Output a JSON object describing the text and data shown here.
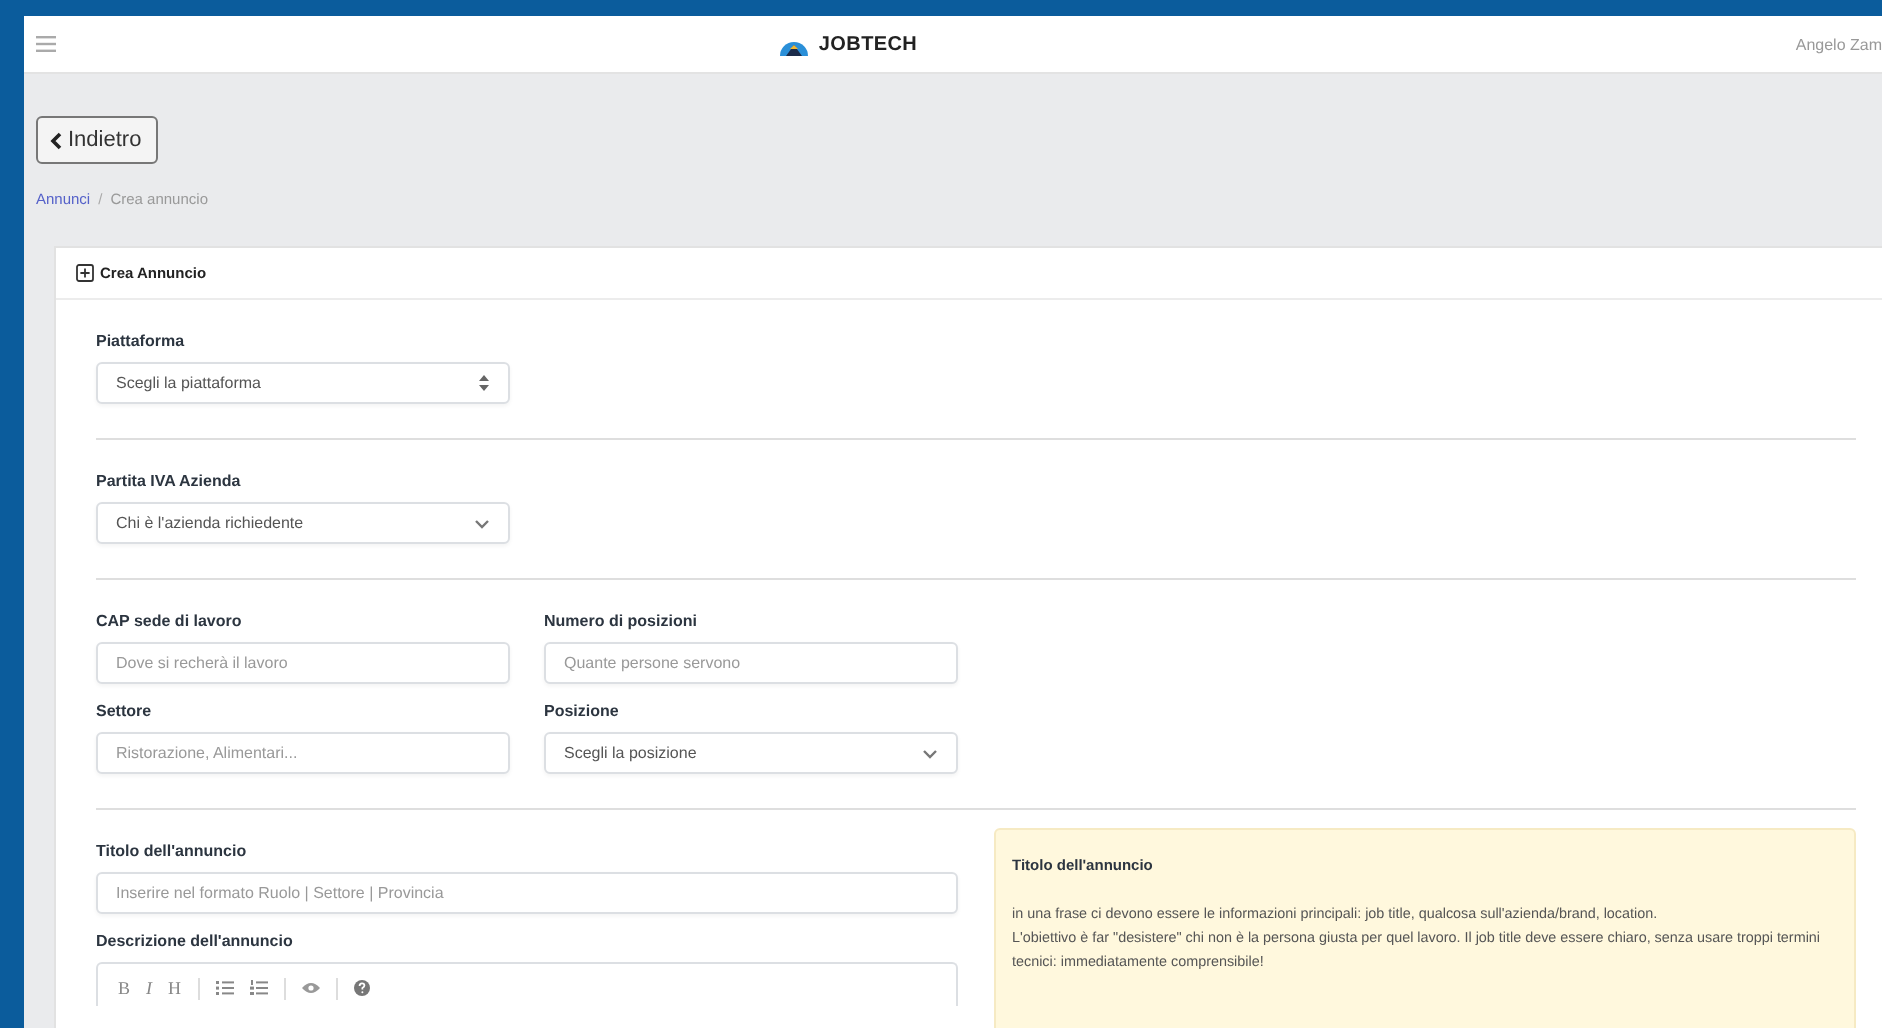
{
  "navbar": {
    "brand": "JOBTECH",
    "user": "Angelo Zam"
  },
  "back_button": {
    "label": "Indietro"
  },
  "breadcrumb": [
    {
      "label": "Annunci",
      "link": true,
      "separator": "/"
    },
    {
      "label": "Crea annuncio",
      "link": false
    }
  ],
  "card": {
    "title": "Crea Annuncio",
    "sections": [
      {
        "fields": [
          {
            "kind": "spin-select",
            "label": "Piattaforma",
            "value": "Scegli la piattaforma"
          }
        ]
      },
      {
        "fields": [
          {
            "kind": "select",
            "label": "Partita IVA Azienda",
            "value": "Chi è l'azienda richiedente"
          }
        ]
      },
      {
        "fields": [
          {
            "kind": "input",
            "label": "CAP sede di lavoro",
            "placeholder": "Dove si recherà il lavoro"
          },
          {
            "kind": "input",
            "label": "Numero di posizioni",
            "placeholder": "Quante persone servono"
          },
          {
            "kind": "input",
            "label": "Settore",
            "placeholder": "Ristorazione, Alimentari..."
          },
          {
            "kind": "select",
            "label": "Posizione",
            "value": "Scegli la posizione"
          }
        ]
      },
      {
        "fields": [
          {
            "kind": "input",
            "label": "Titolo dell'annuncio",
            "placeholder": "Inserire nel formato Ruolo | Settore | Provincia"
          },
          {
            "kind": "editor",
            "label": "Descrizione dell'annuncio",
            "toolbar": [
              {
                "kind": "bold",
                "label": "B"
              },
              {
                "kind": "italic",
                "label": "I"
              },
              {
                "kind": "heading",
                "label": "H"
              },
              {
                "kind": "divider"
              },
              {
                "kind": "bullet-list"
              },
              {
                "kind": "numbered-list"
              },
              {
                "kind": "divider"
              },
              {
                "kind": "preview"
              },
              {
                "kind": "divider"
              },
              {
                "kind": "help"
              }
            ]
          }
        ],
        "hint": {
          "title": "Titolo dell'annuncio",
          "paragraphs": [
            "in una frase ci devono essere le informazioni principali: job title, qualcosa sull'azienda/brand, location.",
            "L'obiettivo è far \"desistere\" chi non è la persona giusta per quel lavoro. Il job title deve essere chiaro, senza usare troppi termini tecnici: immediatamente comprensibile!"
          ]
        }
      }
    ]
  }
}
